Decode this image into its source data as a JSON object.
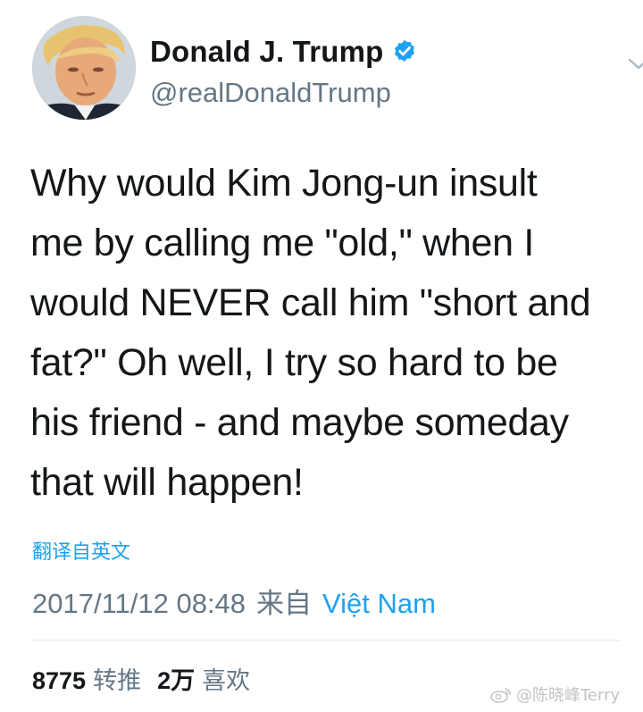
{
  "tweet": {
    "display_name": "Donald J. Trump",
    "handle": "@realDonaldTrump",
    "text": "Why would Kim Jong-un insult\nme by calling me \"old,\" when I\nwould NEVER call him \"short and\nfat?\" Oh well, I try so hard to be\nhis friend - and maybe someday\nthat will happen!",
    "translate_label": "翻译自英文",
    "timestamp": "2017/11/12 08:48",
    "source_prefix": "来自",
    "source": "Việt Nam",
    "retweets": {
      "count": "8775",
      "label": "转推"
    },
    "likes": {
      "count": "2万",
      "label": "喜欢"
    }
  },
  "watermark": {
    "text": "@陈晓峰Terry"
  },
  "colors": {
    "accent": "#1da1f2",
    "secondary_text": "#657786",
    "primary_text": "#14171a",
    "divider": "#e1e8ed"
  },
  "icons": [
    "avatar",
    "verified-badge-icon",
    "chevron-down-icon",
    "weibo-icon"
  ]
}
